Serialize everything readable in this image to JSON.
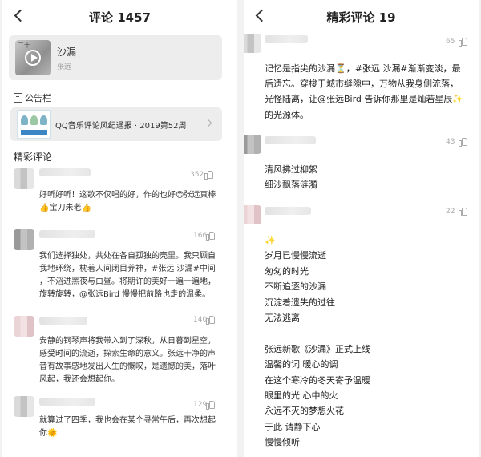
{
  "left": {
    "title": "评论 1457",
    "song": {
      "cover_text": "二十",
      "name": "沙漏",
      "artist": "张远"
    },
    "notice": {
      "label": "公告栏",
      "text": "QQ音乐评论风纪通报 · 2019第52周"
    },
    "section_title": "精彩评论",
    "comments": [
      {
        "likes": "352",
        "text": "好听好听！这歌不仅唱的好，作的也好😊张远真棒\n👍宝刀未老👍"
      },
      {
        "likes": "166",
        "text": "我们选择独处，共处在各自孤独的壳里。我只顾自\n我地环绕，枕着人间闭目养神，#张远 沙漏#中间\n，不滔进黑夜与白昼。将期许的美好一遍一遍地，\n旋转旋转，@张远Bird 慢慢把前路也走的温柔。"
      },
      {
        "likes": "140",
        "text": "安静的钢琴声将我带入到了深秋，从日暮到星空，\n感受时间的流逝，探索生命的意义。张远干净的声\n音有故事感地发出人生的慨叹，是遗憾的美，落叶\n风起，我还会想起你。"
      },
      {
        "likes": "129",
        "text": "就算过了四季，我也会在某个寻常午后，再次想起\n你🌞"
      }
    ]
  },
  "right": {
    "title": "精彩评论 19",
    "comments": [
      {
        "likes": "65",
        "text": "记忆是指尖的沙漏⏳，#张远 沙漏#渐渐变淡，最\n后遗忘。穿梭于城市缝隙中，万物从我身侧流落，\n光怪陆离，让@张远Bird 告诉你那里是灿若星辰✨\n的光源体。"
      },
      {
        "likes": "43",
        "text": "清风拂过柳絮\n细沙飘落涟漪"
      },
      {
        "likes": "22",
        "text": "✨\n岁月已慢慢流逝\n匆匆的时光\n不断追逐的沙漏\n沉淀着遗失的过往\n无法逃离\n\n张远新歌《沙漏》正式上线\n温馨的词 暖心的调\n在这个寒冷的冬天寄予温暖\n眼里的光 心中的火\n永远不灭的梦想火花\n于此 请静下心\n慢慢倾听"
      }
    ]
  }
}
